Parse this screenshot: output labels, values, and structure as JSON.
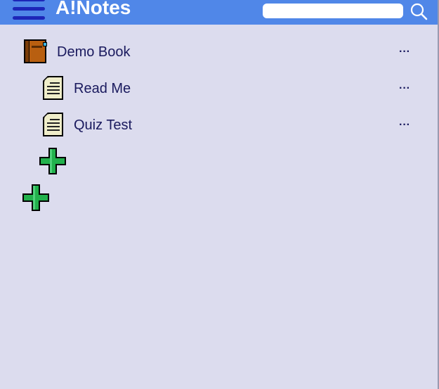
{
  "app": {
    "title": "A!Notes"
  },
  "search": {
    "placeholder": "",
    "value": ""
  },
  "icons": {
    "menu": "hamburger-menu-icon",
    "search": "magnifier-search-icon",
    "book": "book-icon",
    "page": "document-page-icon",
    "add": "green-plus-icon",
    "more": "ellipsis-icon"
  },
  "colors": {
    "header": "#5087e8",
    "menu_bars": "#1d26b8",
    "background": "#dcdcee",
    "text": "#1a1a5e",
    "plus": "#22b14c"
  },
  "tree": {
    "book": {
      "label": "Demo Book",
      "more": "···"
    },
    "pages": [
      {
        "label": "Read Me",
        "more": "···"
      },
      {
        "label": "Quiz Test",
        "more": "···"
      }
    ]
  }
}
